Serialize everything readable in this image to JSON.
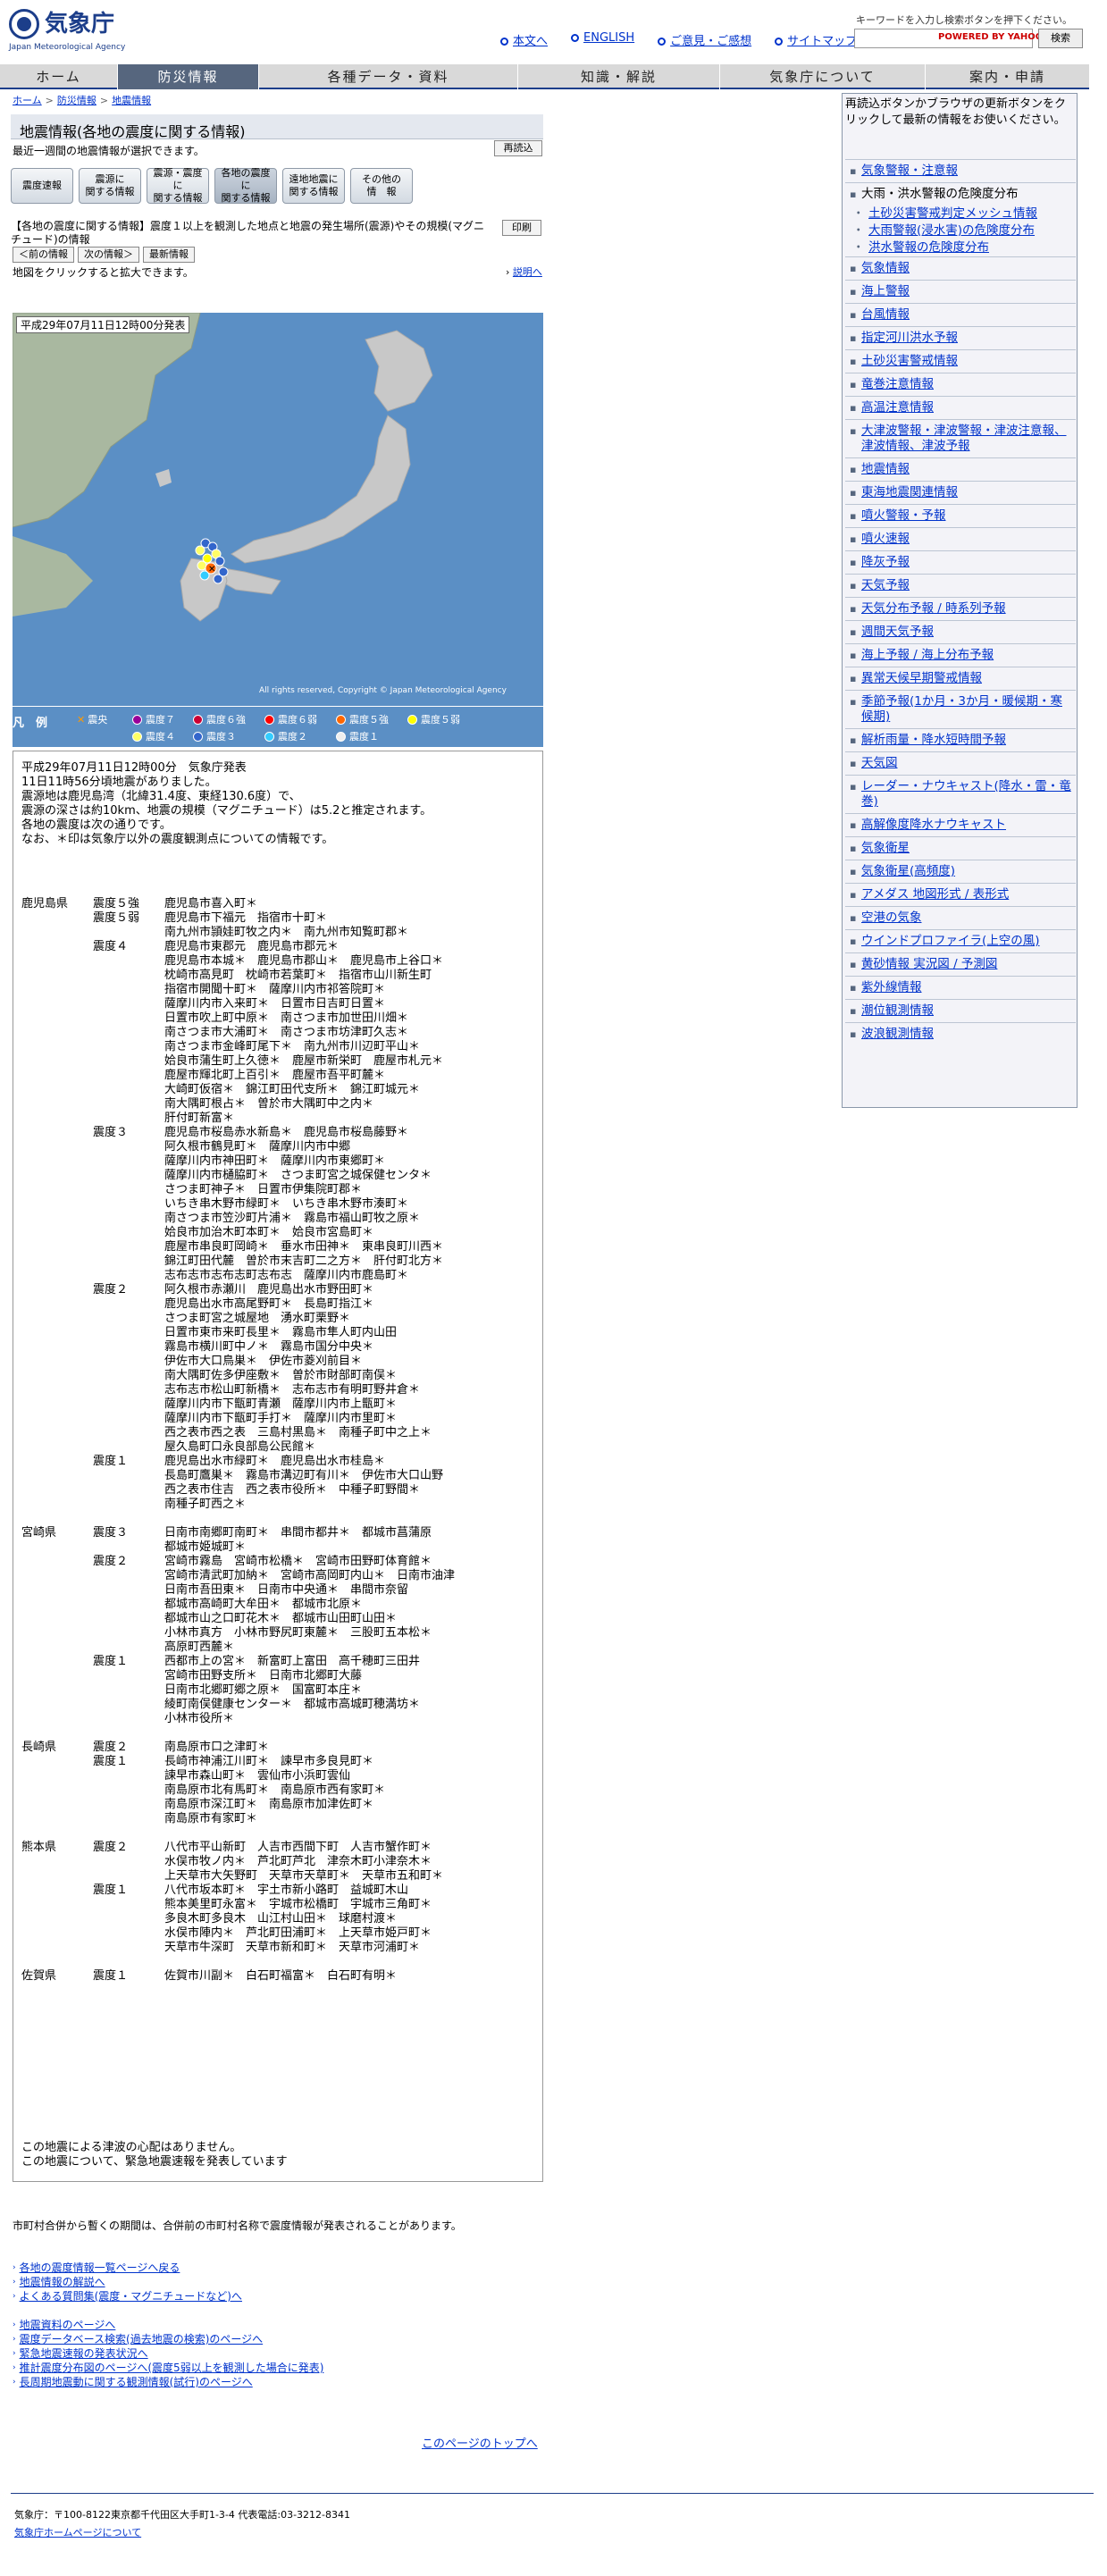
{
  "header": {
    "logo_text": "気象庁",
    "logo_sub": "Japan Meteorological Agency",
    "links": [
      "本文へ",
      "ENGLISH",
      "ご意見・ご感想",
      "サイトマップ"
    ],
    "search_note": "キーワードを入力し検索ボタンを押下ください。",
    "search_brand": "POWERED BY YAHOO!",
    "search_button": "検索"
  },
  "nav": [
    "ホーム",
    "防災情報",
    "各種データ・資料",
    "知識・解説",
    "気象庁について",
    "案内・申請"
  ],
  "breadcrumb": [
    "ホーム",
    "防災情報",
    "地震情報"
  ],
  "section": {
    "title": "地震情報(各地の震度に関する情報)",
    "subtitle": "最近一週間の地震情報が選択できます。",
    "reload": "再読込"
  },
  "tabs": [
    "震度速報",
    "震源に\n関する情報",
    "震源・震度に\n関する情報",
    "各地の震度に\n関する情報",
    "遠地地震に\n関する情報",
    "その他の\n情　報"
  ],
  "info_line": "【各地の震度に関する情報】震度１以上を観測した地点と地震の発生場所(震源)やその規模(マグニチュード)の情報",
  "print": "印刷",
  "nav_buttons": [
    "＜前の情報",
    "次の情報＞",
    "最新情報"
  ],
  "click_hint": "地図をクリックすると拡大できます。",
  "explain": "説明へ",
  "map": {
    "date": "平成29年07月11日12時00分発表",
    "copyright": "All rights reserved, Copyright © Japan Meteorological Agency",
    "legend_title": "凡　例",
    "legend": [
      "震央",
      "震度７",
      "震度６強",
      "震度６弱",
      "震度５強",
      "震度５弱",
      "震度４",
      "震度３",
      "震度２",
      "震度１"
    ],
    "legend_colors": [
      "#ff9900",
      "#990099",
      "#cc0033",
      "#ff0000",
      "#ff6600",
      "#ffff00",
      "#ffff66",
      "#3366cc",
      "#33ccff",
      "#eeeeee"
    ]
  },
  "report_text": "平成29年07月11日12時00分　気象庁発表\n11日11時56分頃地震がありました。\n震源地は鹿児島湾（北緯31.4度、東経130.6度）で、\n震源の深さは約10km、地震の規模（マグニチュード）は5.2と推定されます。\n各地の震度は次の通りです。\nなお、＊印は気象庁以外の震度観測点についての情報です。",
  "intensity_rows": [
    [
      "鹿児島県",
      "震度５強",
      "鹿児島市喜入町＊"
    ],
    [
      "",
      "震度５弱",
      "鹿児島市下福元　指宿市十町＊"
    ],
    [
      "",
      "",
      "南九州市頴娃町牧之内＊　南九州市知覧町郡＊"
    ],
    [
      "",
      "震度４",
      "鹿児島市東郡元　鹿児島市郡元＊"
    ],
    [
      "",
      "",
      "鹿児島市本城＊　鹿児島市郡山＊　鹿児島市上谷口＊"
    ],
    [
      "",
      "",
      "枕崎市高見町　枕崎市若葉町＊　指宿市山川新生町"
    ],
    [
      "",
      "",
      "指宿市開聞十町＊　薩摩川内市祁答院町＊"
    ],
    [
      "",
      "",
      "薩摩川内市入来町＊　日置市日吉町日置＊"
    ],
    [
      "",
      "",
      "日置市吹上町中原＊　南さつま市加世田川畑＊"
    ],
    [
      "",
      "",
      "南さつま市大浦町＊　南さつま市坊津町久志＊"
    ],
    [
      "",
      "",
      "南さつま市金峰町尾下＊　南九州市川辺町平山＊"
    ],
    [
      "",
      "",
      "姶良市蒲生町上久徳＊　鹿屋市新栄町　鹿屋市札元＊"
    ],
    [
      "",
      "",
      "鹿屋市輝北町上百引＊　鹿屋市吾平町麓＊"
    ],
    [
      "",
      "",
      "大崎町仮宿＊　錦江町田代支所＊　錦江町城元＊"
    ],
    [
      "",
      "",
      "南大隅町根占＊　曽於市大隅町中之内＊"
    ],
    [
      "",
      "",
      "肝付町新富＊"
    ],
    [
      "",
      "震度３",
      "鹿児島市桜島赤水新島＊　鹿児島市桜島藤野＊"
    ],
    [
      "",
      "",
      "阿久根市鶴見町＊　薩摩川内市中郷"
    ],
    [
      "",
      "",
      "薩摩川内市神田町＊　薩摩川内市東郷町＊"
    ],
    [
      "",
      "",
      "薩摩川内市樋脇町＊　さつま町宮之城保健センタ＊"
    ],
    [
      "",
      "",
      "さつま町神子＊　日置市伊集院町郡＊"
    ],
    [
      "",
      "",
      "いちき串木野市緑町＊　いちき串木野市湊町＊"
    ],
    [
      "",
      "",
      "南さつま市笠沙町片浦＊　霧島市福山町牧之原＊"
    ],
    [
      "",
      "",
      "姶良市加治木町本町＊　姶良市宮島町＊"
    ],
    [
      "",
      "",
      "鹿屋市串良町岡崎＊　垂水市田神＊　東串良町川西＊"
    ],
    [
      "",
      "",
      "錦江町田代麓　曽於市末吉町二之方＊　肝付町北方＊"
    ],
    [
      "",
      "",
      "志布志市志布志町志布志　薩摩川内市鹿島町＊"
    ],
    [
      "",
      "震度２",
      "阿久根市赤瀬川　鹿児島出水市野田町＊"
    ],
    [
      "",
      "",
      "鹿児島出水市高尾野町＊　長島町指江＊"
    ],
    [
      "",
      "",
      "さつま町宮之城屋地　湧水町栗野＊"
    ],
    [
      "",
      "",
      "日置市東市来町長里＊　霧島市隼人町内山田"
    ],
    [
      "",
      "",
      "霧島市横川町中ノ＊　霧島市国分中央＊"
    ],
    [
      "",
      "",
      "伊佐市大口鳥巣＊　伊佐市菱刈前目＊"
    ],
    [
      "",
      "",
      "南大隅町佐多伊座敷＊　曽於市財部町南俣＊"
    ],
    [
      "",
      "",
      "志布志市松山町新橋＊　志布志市有明町野井倉＊"
    ],
    [
      "",
      "",
      "薩摩川内市下甑町青瀬　薩摩川内市上甑町＊"
    ],
    [
      "",
      "",
      "薩摩川内市下甑町手打＊　薩摩川内市里町＊"
    ],
    [
      "",
      "",
      "西之表市西之表　三島村黒島＊　南種子町中之上＊"
    ],
    [
      "",
      "",
      "屋久島町口永良部島公民館＊"
    ],
    [
      "",
      "震度１",
      "鹿児島出水市緑町＊　鹿児島出水市桂島＊"
    ],
    [
      "",
      "",
      "長島町鷹巣＊　霧島市溝辺町有川＊　伊佐市大口山野"
    ],
    [
      "",
      "",
      "西之表市住吉　西之表市役所＊　中種子町野間＊"
    ],
    [
      "",
      "",
      "南種子町西之＊"
    ],
    [
      "宮崎県",
      "震度３",
      "日南市南郷町南町＊　串間市都井＊　都城市菖蒲原"
    ],
    [
      "",
      "",
      "都城市姫城町＊"
    ],
    [
      "",
      "震度２",
      "宮崎市霧島　宮崎市松橋＊　宮崎市田野町体育館＊"
    ],
    [
      "",
      "",
      "宮崎市清武町加納＊　宮崎市高岡町内山＊　日南市油津"
    ],
    [
      "",
      "",
      "日南市吾田東＊　日南市中央通＊　串間市奈留"
    ],
    [
      "",
      "",
      "都城市高崎町大牟田＊　都城市北原＊"
    ],
    [
      "",
      "",
      "都城市山之口町花木＊　都城市山田町山田＊"
    ],
    [
      "",
      "",
      "小林市真方　小林市野尻町東麓＊　三股町五本松＊"
    ],
    [
      "",
      "",
      "高原町西麓＊"
    ],
    [
      "",
      "震度１",
      "西都市上の宮＊　新富町上富田　高千穂町三田井"
    ],
    [
      "",
      "",
      "宮崎市田野支所＊　日南市北郷町大藤"
    ],
    [
      "",
      "",
      "日南市北郷町郷之原＊　国富町本庄＊"
    ],
    [
      "",
      "",
      "綾町南俣健康センター＊　都城市高城町穂満坊＊"
    ],
    [
      "",
      "",
      "小林市役所＊"
    ],
    [
      "長崎県",
      "震度２",
      "南島原市口之津町＊"
    ],
    [
      "",
      "震度１",
      "長崎市神浦江川町＊　諫早市多良見町＊"
    ],
    [
      "",
      "",
      "諫早市森山町＊　雲仙市小浜町雲仙"
    ],
    [
      "",
      "",
      "南島原市北有馬町＊　南島原市西有家町＊"
    ],
    [
      "",
      "",
      "南島原市深江町＊　南島原市加津佐町＊"
    ],
    [
      "",
      "",
      "南島原市有家町＊"
    ],
    [
      "熊本県",
      "震度２",
      "八代市平山新町　人吉市西間下町　人吉市蟹作町＊"
    ],
    [
      "",
      "",
      "水俣市牧ノ内＊　芦北町芦北　津奈木町小津奈木＊"
    ],
    [
      "",
      "",
      "上天草市大矢野町　天草市天草町＊　天草市五和町＊"
    ],
    [
      "",
      "震度１",
      "八代市坂本町＊　宇土市新小路町　益城町木山"
    ],
    [
      "",
      "",
      "熊本美里町永富＊　宇城市松橋町　宇城市三角町＊"
    ],
    [
      "",
      "",
      "多良木町多良木　山江村山田＊　球磨村渡＊"
    ],
    [
      "",
      "",
      "水俣市陣内＊　芦北町田浦町＊　上天草市姫戸町＊"
    ],
    [
      "",
      "",
      "天草市牛深町　天草市新和町＊　天草市河浦町＊"
    ],
    [
      "佐賀県",
      "震度１",
      "佐賀市川副＊　白石町福富＊　白石町有明＊"
    ]
  ],
  "report_footer": "この地震による津波の心配はありません。\nこの地震について、緊急地震速報を発表しています",
  "bottom_note": "市町村合併から暫くの期間は、合併前の市町村名称で震度情報が発表されることがあります。",
  "links_group1": [
    "各地の震度情報一覧ページへ戻る",
    "地震情報の解説へ",
    "よくある質問集(震度・マグニチュードなど)へ"
  ],
  "links_group2": [
    "地震資料のページへ",
    "震度データベース検索(過去地震の検索)のページへ",
    "緊急地震速報の発表状況へ",
    "推計震度分布図のページへ(震度5弱以上を観測した場合に発表)",
    "長周期地震動に関する観測情報(試行)のページへ"
  ],
  "page_top": "このページのトップへ",
  "address": "気象庁：〒100-8122東京都千代田区大手町1-3-4 代表電話:03-3212-8341",
  "home_link": "気象庁ホームページについて",
  "sidebar": {
    "intro": "再読込ボタンかブラウザの更新ボタンをクリックして最新の情報をお使いください。",
    "items": [
      {
        "t": "気象警報・注意報"
      },
      {
        "t": "大雨・洪水警報の危険度分布",
        "plain": true,
        "subs": [
          "土砂災害警戒判定メッシュ情報",
          "大雨警報(浸水害)の危険度分布",
          "洪水警報の危険度分布"
        ]
      },
      {
        "t": "気象情報"
      },
      {
        "t": "海上警報"
      },
      {
        "t": "台風情報"
      },
      {
        "t": "指定河川洪水予報"
      },
      {
        "t": "土砂災害警戒情報"
      },
      {
        "t": "竜巻注意情報"
      },
      {
        "t": "高温注意情報"
      },
      {
        "t": "大津波警報・津波警報・津波注意報、津波情報、津波予報"
      },
      {
        "t": "地震情報"
      },
      {
        "t": "東海地震関連情報"
      },
      {
        "t": "噴火警報・予報"
      },
      {
        "t": "噴火速報"
      },
      {
        "t": "降灰予報"
      },
      {
        "t": "天気予報"
      },
      {
        "t": "天気分布予報 / 時系列予報"
      },
      {
        "t": "週間天気予報"
      },
      {
        "t": "海上予報 / 海上分布予報"
      },
      {
        "t": "異常天候早期警戒情報"
      },
      {
        "t": "季節予報(1か月・3か月・暖候期・寒候期)"
      },
      {
        "t": "解析雨量・降水短時間予報"
      },
      {
        "t": "天気図"
      },
      {
        "t": "レーダー・ナウキャスト(降水・雷・竜巻)"
      },
      {
        "t": "高解像度降水ナウキャスト"
      },
      {
        "t": "気象衛星"
      },
      {
        "t": "気象衛星(高頻度)"
      },
      {
        "t": "アメダス 地図形式 / 表形式"
      },
      {
        "t": "空港の気象"
      },
      {
        "t": "ウインドプロファイラ(上空の風)"
      },
      {
        "t": "黄砂情報 実況図 / 予測図"
      },
      {
        "t": "紫外線情報"
      },
      {
        "t": "潮位観測情報"
      },
      {
        "t": "波浪観測情報"
      }
    ]
  }
}
